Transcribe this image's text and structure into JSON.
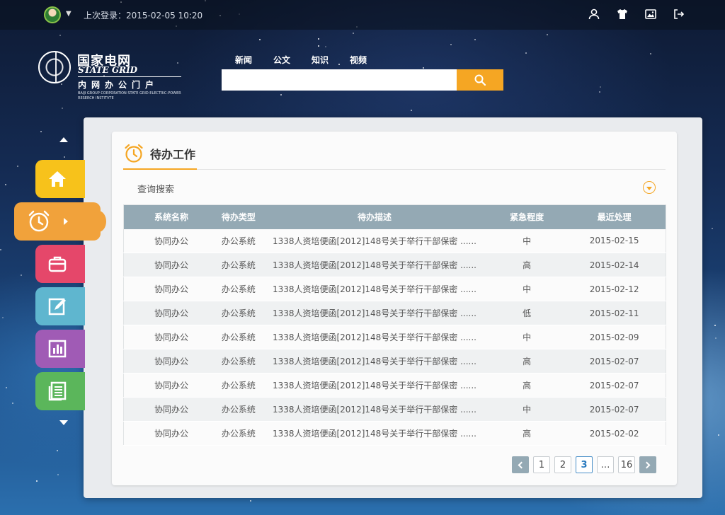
{
  "header": {
    "last_login_label": "上次登录：2015-02-05   10:20"
  },
  "logo": {
    "cn_name": "国家电网",
    "en_name": "STATE GRID",
    "portal_name": "内网办公门户",
    "org_line": "BAIJI GROUP CORPORATION STATE GRID ELECTRIC-POWER RESERCH INSTITVTE"
  },
  "search": {
    "tabs": [
      {
        "label": "新闻",
        "active": true
      },
      {
        "label": "公文",
        "active": false
      },
      {
        "label": "知识",
        "active": false
      },
      {
        "label": "视频",
        "active": false
      }
    ],
    "value": "",
    "placeholder": ""
  },
  "sidebar": {
    "items": [
      {
        "icon": "home-icon",
        "color": "#f7c21b"
      },
      {
        "icon": "alarm-clock-icon",
        "color": "#f1a23b",
        "active": true
      },
      {
        "icon": "briefcase-icon",
        "color": "#e5476a"
      },
      {
        "icon": "edit-icon",
        "color": "#5fb6cf"
      },
      {
        "icon": "bar-chart-icon",
        "color": "#a05bb5"
      },
      {
        "icon": "document-icon",
        "color": "#5bb65b"
      }
    ]
  },
  "card": {
    "title": "待办工作",
    "query_label": "查询搜索"
  },
  "table": {
    "headers": [
      "系统名称",
      "待办类型",
      "待办描述",
      "紧急程度",
      "最近处理"
    ],
    "rows": [
      [
        "协同办公",
        "办公系统",
        "1338人资培便函[2012]148号关于举行干部保密  ......",
        "中",
        "2015-02-15"
      ],
      [
        "协同办公",
        "办公系统",
        "1338人资培便函[2012]148号关于举行干部保密  ......",
        "高",
        "2015-02-14"
      ],
      [
        "协同办公",
        "办公系统",
        "1338人资培便函[2012]148号关于举行干部保密  ......",
        "中",
        "2015-02-12"
      ],
      [
        "协同办公",
        "办公系统",
        "1338人资培便函[2012]148号关于举行干部保密  ......",
        "低",
        "2015-02-11"
      ],
      [
        "协同办公",
        "办公系统",
        "1338人资培便函[2012]148号关于举行干部保密  ......",
        "中",
        "2015-02-09"
      ],
      [
        "协同办公",
        "办公系统",
        "1338人资培便函[2012]148号关于举行干部保密  ......",
        "高",
        "2015-02-07"
      ],
      [
        "协同办公",
        "办公系统",
        "1338人资培便函[2012]148号关于举行干部保密  ......",
        "高",
        "2015-02-07"
      ],
      [
        "协同办公",
        "办公系统",
        "1338人资培便函[2012]148号关于举行干部保密  ......",
        "中",
        "2015-02-07"
      ],
      [
        "协同办公",
        "办公系统",
        "1338人资培便函[2012]148号关于举行干部保密  ......",
        "高",
        "2015-02-02"
      ]
    ]
  },
  "pagination": {
    "pages": [
      "1",
      "2",
      "3",
      "…",
      "16"
    ],
    "current": "3"
  },
  "colors": {
    "accent": "#f5a623",
    "table_header": "#94a9b4"
  }
}
